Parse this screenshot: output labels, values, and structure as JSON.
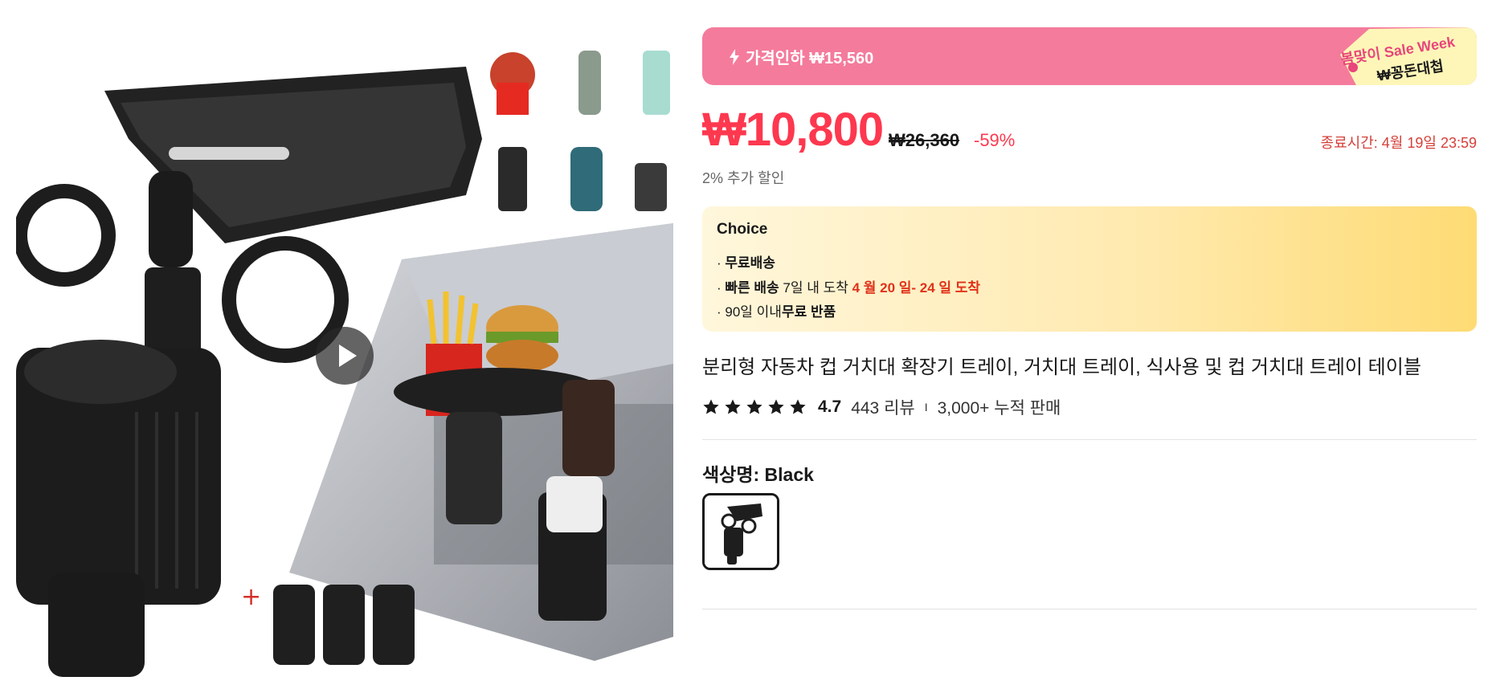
{
  "gallery": {
    "play_icon": "play-icon"
  },
  "sale_banner": {
    "icon": "lightning-bolt-icon",
    "label": "가격인하 ₩15,560",
    "tag_line1": "봄맞이 Sale Week",
    "tag_line2": "₩꽁돈대첩"
  },
  "price": {
    "current": "₩10,800",
    "original": "₩26,360",
    "discount": "-59%",
    "end_time": "종료시간: 4월 19일 23:59",
    "extra_discount": "2% 추가 할인"
  },
  "choice": {
    "title": "Choice",
    "line1": {
      "bullet": "· ",
      "bold": "무료배송"
    },
    "line2": {
      "bullet": "· ",
      "bold": "빠른 배송 ",
      "text": "7일 내 도착 ",
      "red": "4 월 20 일- 24 일 도착"
    },
    "line3": {
      "bullet": "· ",
      "text": "90일 이내",
      "bold": "무료 반품"
    }
  },
  "product": {
    "title": "분리형 자동차 컵 거치대 확장기 트레이, 거치대 트레이, 식사용 및 컵 거치대 트레이 테이블",
    "rating": "4.7",
    "reviews": "443 리뷰",
    "separator": "I",
    "sales": "3,000+ 누적 판매",
    "star_count": 5,
    "star_color": "#191919"
  },
  "variant": {
    "label": "색상명: Black"
  },
  "colors": {
    "accent": "#fd384f",
    "banner": "#f47b9c",
    "delivery_red": "#e0311a"
  }
}
